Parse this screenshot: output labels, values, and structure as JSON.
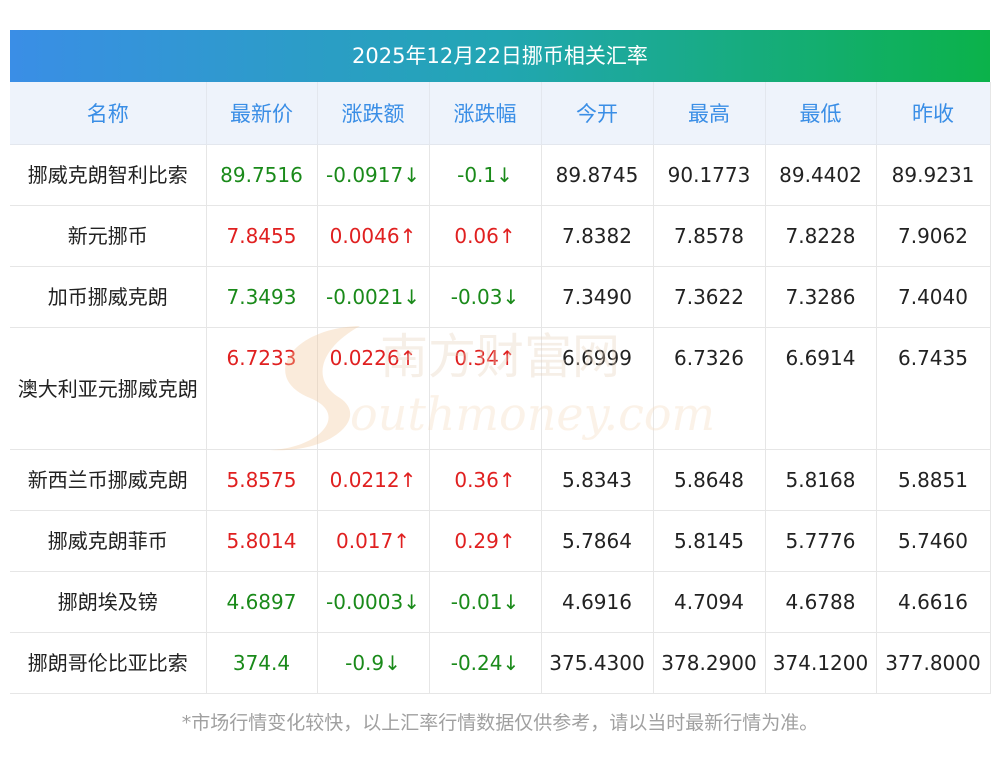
{
  "title": "2025年12月22日挪币相关汇率",
  "headers": [
    "名称",
    "最新价",
    "涨跌额",
    "涨跌幅",
    "今开",
    "最高",
    "最低",
    "昨收"
  ],
  "rows": [
    {
      "name": "挪威克朗智利比索",
      "latest": "89.7516",
      "change": "-0.0917↓",
      "pct": "-0.1↓",
      "open": "89.8745",
      "high": "90.1773",
      "low": "89.4402",
      "prev": "89.9231",
      "dir": "down"
    },
    {
      "name": "新元挪币",
      "latest": "7.8455",
      "change": "0.0046↑",
      "pct": "0.06↑",
      "open": "7.8382",
      "high": "7.8578",
      "low": "7.8228",
      "prev": "7.9062",
      "dir": "up"
    },
    {
      "name": "加币挪威克朗",
      "latest": "7.3493",
      "change": "-0.0021↓",
      "pct": "-0.03↓",
      "open": "7.3490",
      "high": "7.3622",
      "low": "7.3286",
      "prev": "7.4040",
      "dir": "down"
    },
    {
      "name": "澳大利亚元挪威克朗",
      "latest": "6.7233",
      "change": "0.0226↑",
      "pct": "0.34↑",
      "open": "6.6999",
      "high": "6.7326",
      "low": "6.6914",
      "prev": "6.7435",
      "dir": "up"
    },
    {
      "name": "新西兰币挪威克朗",
      "latest": "5.8575",
      "change": "0.0212↑",
      "pct": "0.36↑",
      "open": "5.8343",
      "high": "5.8648",
      "low": "5.8168",
      "prev": "5.8851",
      "dir": "up"
    },
    {
      "name": "挪威克朗菲币",
      "latest": "5.8014",
      "change": "0.017↑",
      "pct": "0.29↑",
      "open": "5.7864",
      "high": "5.8145",
      "low": "5.7776",
      "prev": "5.7460",
      "dir": "up"
    },
    {
      "name": "挪朗埃及镑",
      "latest": "4.6897",
      "change": "-0.0003↓",
      "pct": "-0.01↓",
      "open": "4.6916",
      "high": "4.7094",
      "low": "4.6788",
      "prev": "4.6616",
      "dir": "down"
    },
    {
      "name": "挪朗哥伦比亚比索",
      "latest": "374.4",
      "change": "-0.9↓",
      "pct": "-0.24↓",
      "open": "375.4300",
      "high": "378.2900",
      "low": "374.1200",
      "prev": "377.8000",
      "dir": "down"
    }
  ],
  "watermark": {
    "cn": "南方财富网",
    "en": "outhmoney.com"
  },
  "footnote": "*市场行情变化较快，以上汇率行情数据仅供参考，请以当时最新行情为准。",
  "colors": {
    "up": "#e02020",
    "down": "#1a8a1a",
    "header_text": "#3a8ee6"
  }
}
